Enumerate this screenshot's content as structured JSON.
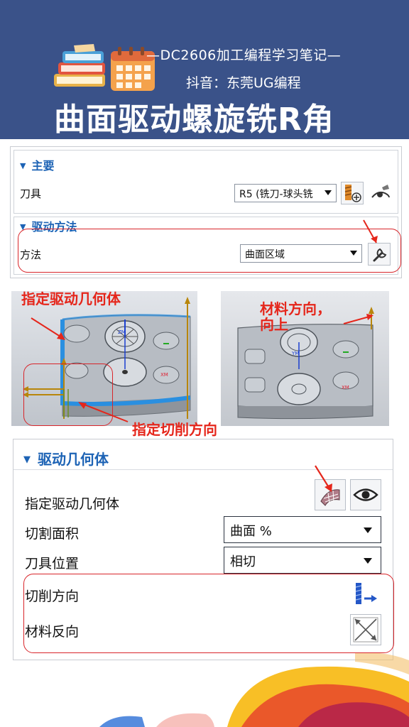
{
  "banner": {
    "subtitle_line1": "—DC2606加工编程学习笔记—",
    "subtitle_line2": "抖音：东莞UG编程",
    "title": "曲面驱动螺旋铣R角",
    "bg_color": "#3a5289"
  },
  "panel1": {
    "section_main": "主要",
    "tool_label": "刀具",
    "tool_value": "R5 (铣刀-球头铣",
    "section_drive": "驱动方法",
    "method_label": "方法",
    "method_value": "曲面区域"
  },
  "annotations": {
    "specify_drive_geometry": "指定驱动几何体",
    "material_direction_line1": "材料方向，",
    "material_direction_line2": "向上",
    "specify_cut_direction": "指定切削方向"
  },
  "model_labels": {
    "zm": "ZM",
    "xm": "XM",
    "ym": "YM"
  },
  "panel2": {
    "section": "驱动几何体",
    "specify_drive_geometry": "指定驱动几何体",
    "cut_area_label": "切割面积",
    "cut_area_value": "曲面 %",
    "tool_position_label": "刀具位置",
    "tool_position_value": "相切",
    "cut_direction_label": "切削方向",
    "material_reverse_label": "材料反向"
  },
  "colors": {
    "accent_blue": "#1d63b5",
    "annotation_red": "#e5261b"
  }
}
